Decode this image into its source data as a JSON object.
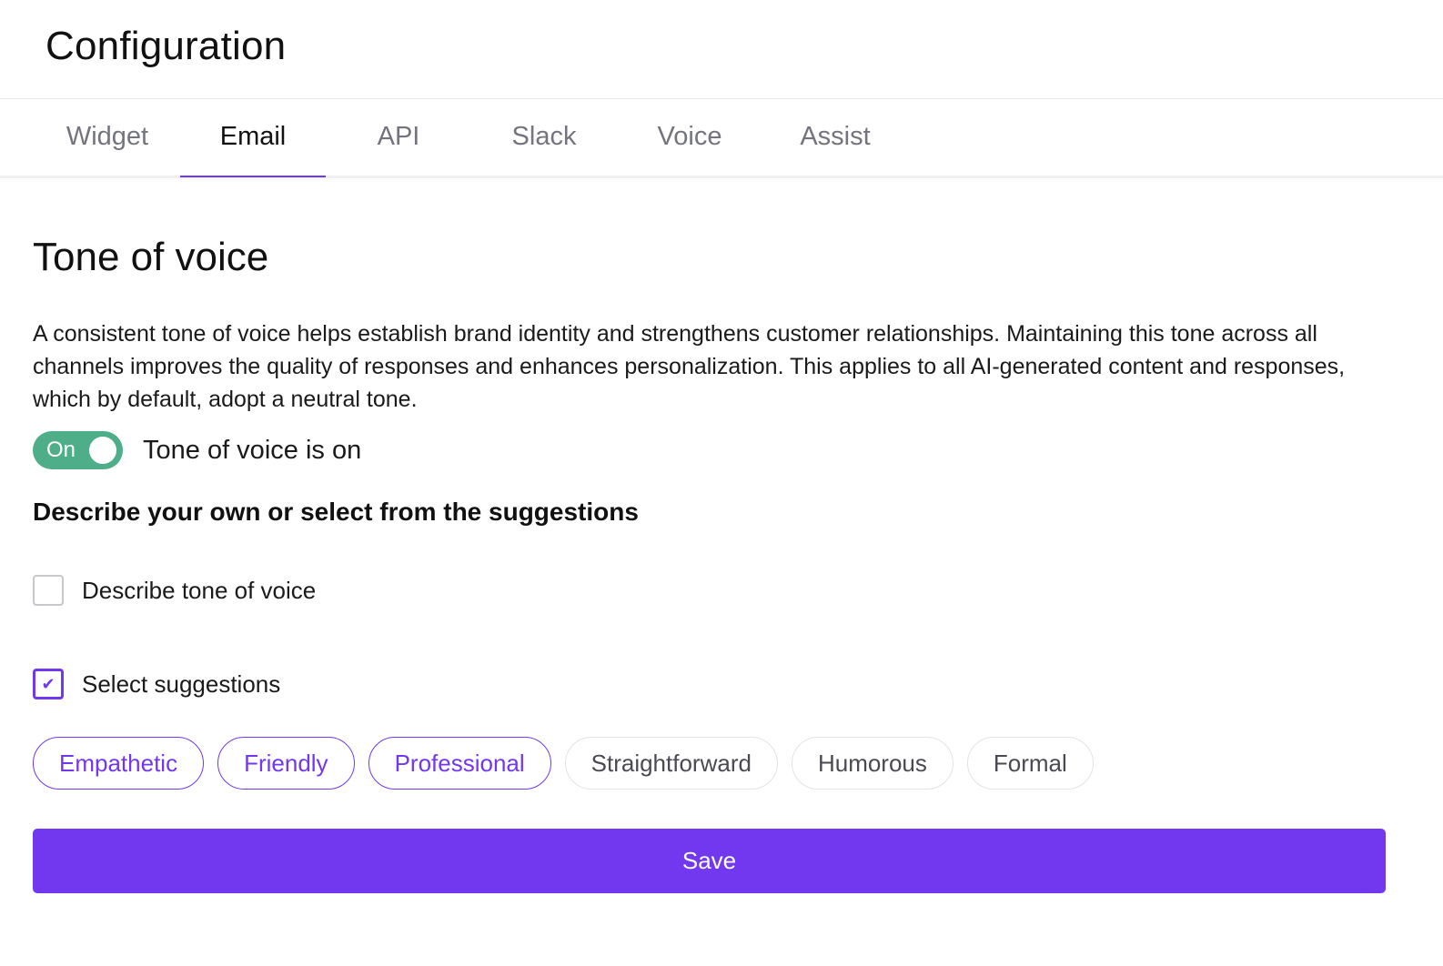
{
  "header": {
    "title": "Configuration"
  },
  "tabs": [
    {
      "label": "Widget",
      "active": false
    },
    {
      "label": "Email",
      "active": true
    },
    {
      "label": "API",
      "active": false
    },
    {
      "label": "Slack",
      "active": false
    },
    {
      "label": "Voice",
      "active": false
    },
    {
      "label": "Assist",
      "active": false
    }
  ],
  "section": {
    "title": "Tone of voice",
    "description": "A consistent tone of voice helps establish brand identity and strengthens customer relationships. Maintaining this tone across all channels improves the quality of responses and enhances personalization. This applies to all AI-generated content and responses, which by default, adopt a neutral tone.",
    "toggle": {
      "state_text": "On",
      "label": "Tone of voice is on",
      "on": true
    },
    "subheading": "Describe your own or select from the suggestions",
    "options": [
      {
        "label": "Describe tone of voice",
        "checked": false
      },
      {
        "label": "Select suggestions",
        "checked": true
      }
    ],
    "suggestions": [
      {
        "label": "Empathetic",
        "selected": true
      },
      {
        "label": "Friendly",
        "selected": true
      },
      {
        "label": "Professional",
        "selected": true
      },
      {
        "label": "Straightforward",
        "selected": false
      },
      {
        "label": "Humorous",
        "selected": false
      },
      {
        "label": "Formal",
        "selected": false
      }
    ],
    "save_label": "Save"
  },
  "colors": {
    "accent": "#7138f0",
    "toggle_on": "#4fae8a",
    "muted_text": "#74747e",
    "border": "#e3e3e8"
  },
  "icons": {
    "checkbox_check": "check-icon"
  }
}
